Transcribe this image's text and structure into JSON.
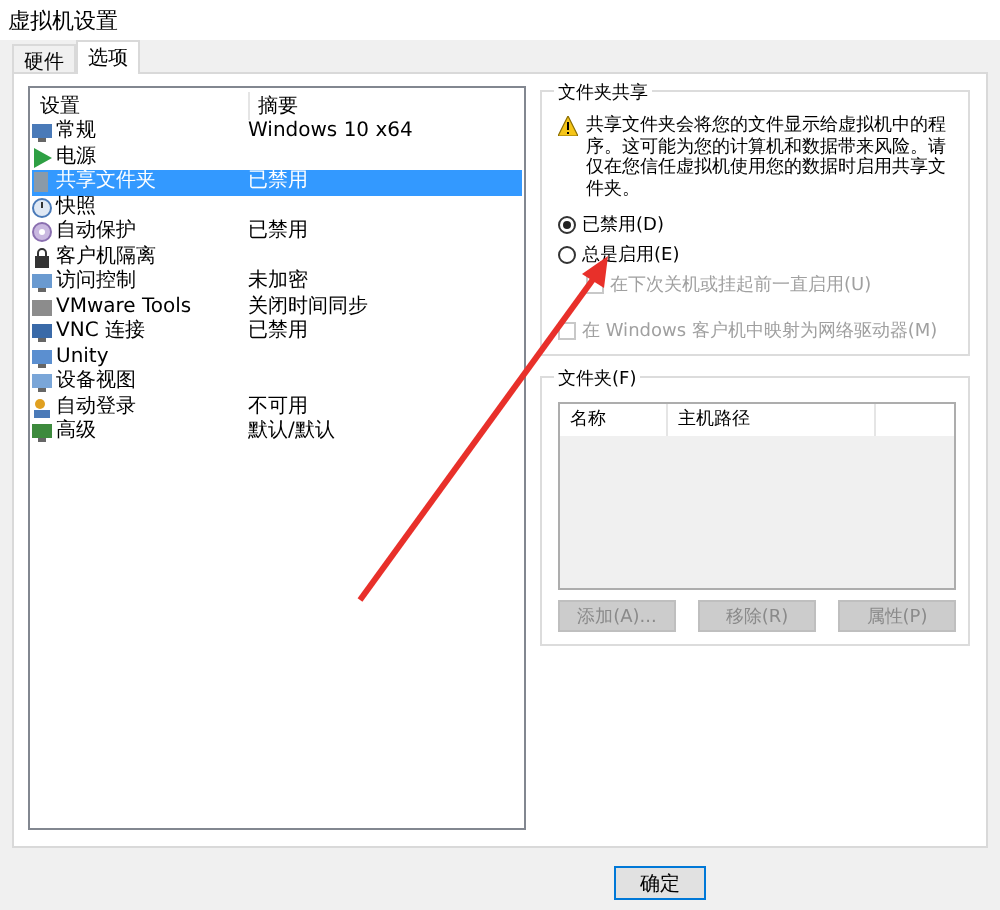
{
  "window": {
    "title": "虚拟机设置"
  },
  "tabs": [
    {
      "label": "硬件",
      "selected": false
    },
    {
      "label": "选项",
      "selected": true
    }
  ],
  "settings_list": {
    "columns": [
      "设置",
      "摘要"
    ],
    "rows": [
      {
        "setting": "常规",
        "summary": "Windows 10 x64",
        "selected": false
      },
      {
        "setting": "电源",
        "selected": false
      },
      {
        "setting": "共享文件夹",
        "summary": "已禁用",
        "selected": true
      },
      {
        "setting": "快照",
        "selected": false
      },
      {
        "setting": "自动保护",
        "summary": "已禁用",
        "selected": false
      },
      {
        "setting": "客户机隔离",
        "selected": false
      },
      {
        "setting": "访问控制",
        "summary": "未加密",
        "selected": false
      },
      {
        "setting": "VMware Tools",
        "summary": "关闭时间同步",
        "selected": false
      },
      {
        "setting": "VNC 连接",
        "summary": "已禁用",
        "selected": false
      },
      {
        "setting": "Unity",
        "selected": false
      },
      {
        "setting": "设备视图",
        "selected": false
      },
      {
        "setting": "自动登录",
        "summary": "不可用",
        "selected": false
      },
      {
        "setting": "高级",
        "summary": "默认/默认",
        "selected": false
      }
    ]
  },
  "folder_sharing": {
    "title": "文件夹共享",
    "warning": "共享文件夹会将您的文件显示给虚拟机中的程序。这可能为您的计算机和数据带来风险。请仅在您信任虚拟机使用您的数据时启用共享文件夹。",
    "options": [
      {
        "kind": "radio",
        "label": "已禁用(D)",
        "checked": true,
        "disabled": false
      },
      {
        "kind": "radio",
        "label": "总是启用(E)",
        "checked": false,
        "disabled": false,
        "children": [
          {
            "kind": "checkbox",
            "label": "在下次关机或挂起前一直启用(U)",
            "checked": false,
            "disabled": true
          }
        ]
      },
      {
        "kind": "checkbox",
        "label": "在 Windows 客户机中映射为网络驱动器(M)",
        "checked": false,
        "disabled": true
      }
    ]
  },
  "folders": {
    "title": "文件夹(F)",
    "columns": [
      "名称",
      "主机路径"
    ],
    "buttons": [
      {
        "label": "添加(A)...",
        "disabled": true
      },
      {
        "label": "移除(R)",
        "disabled": true
      },
      {
        "label": "属性(P)",
        "disabled": true
      }
    ]
  },
  "footer_buttons": [
    {
      "label": "确定"
    }
  ]
}
